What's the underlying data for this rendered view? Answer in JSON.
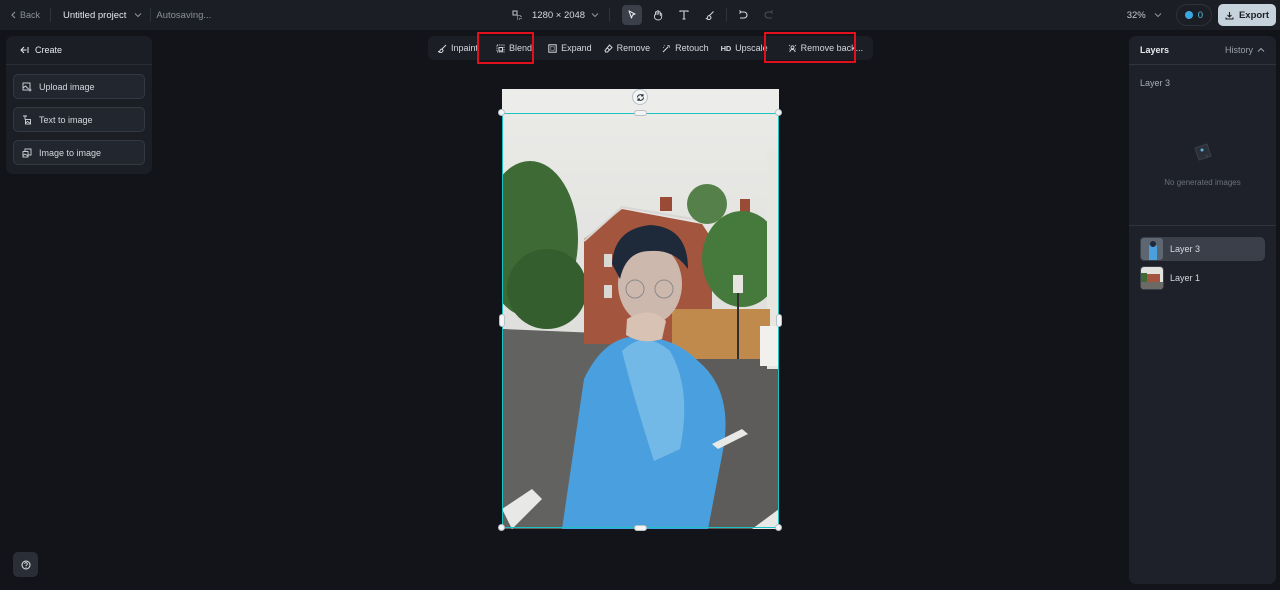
{
  "topbar": {
    "back_label": "Back",
    "project_name": "Untitled project",
    "status": "Autosaving...",
    "canvas_size": "1280 × 2048",
    "zoom": "32%",
    "credits": "0",
    "export_label": "Export"
  },
  "tools": [
    "frame-icon",
    "select-icon",
    "hand-icon",
    "text-icon",
    "brush-icon",
    "undo-icon",
    "redo-icon"
  ],
  "ai_toolbar": {
    "items": [
      {
        "label": "Inpaint",
        "icon": "inpaint-icon"
      },
      {
        "label": "Blend",
        "icon": "blend-icon",
        "highlighted": true
      },
      {
        "label": "Expand",
        "icon": "expand-icon"
      },
      {
        "label": "Remove",
        "icon": "eraser-icon"
      },
      {
        "label": "Retouch",
        "icon": "magic-wand-icon"
      },
      {
        "label": "Upscale",
        "icon": "hd-icon",
        "icon_text": "HD"
      },
      {
        "label": "Remove back...",
        "icon": "remove-background-icon",
        "highlighted": true
      }
    ]
  },
  "left_panel": {
    "title": "Create",
    "buttons": [
      {
        "label": "Upload image",
        "icon": "upload-image-icon"
      },
      {
        "label": "Text to image",
        "icon": "text-to-image-icon"
      },
      {
        "label": "Image to image",
        "icon": "image-to-image-icon"
      }
    ]
  },
  "right_panel": {
    "title": "Layers",
    "history_label": "History",
    "current_layer": "Layer 3",
    "empty_text": "No generated images",
    "layers": [
      {
        "name": "Layer 3",
        "selected": true
      },
      {
        "name": "Layer 1",
        "selected": false
      }
    ]
  },
  "colors": {
    "accent_selection": "#19c3c4",
    "highlight": "#e0101d",
    "export_bg": "#c7d3dc"
  }
}
